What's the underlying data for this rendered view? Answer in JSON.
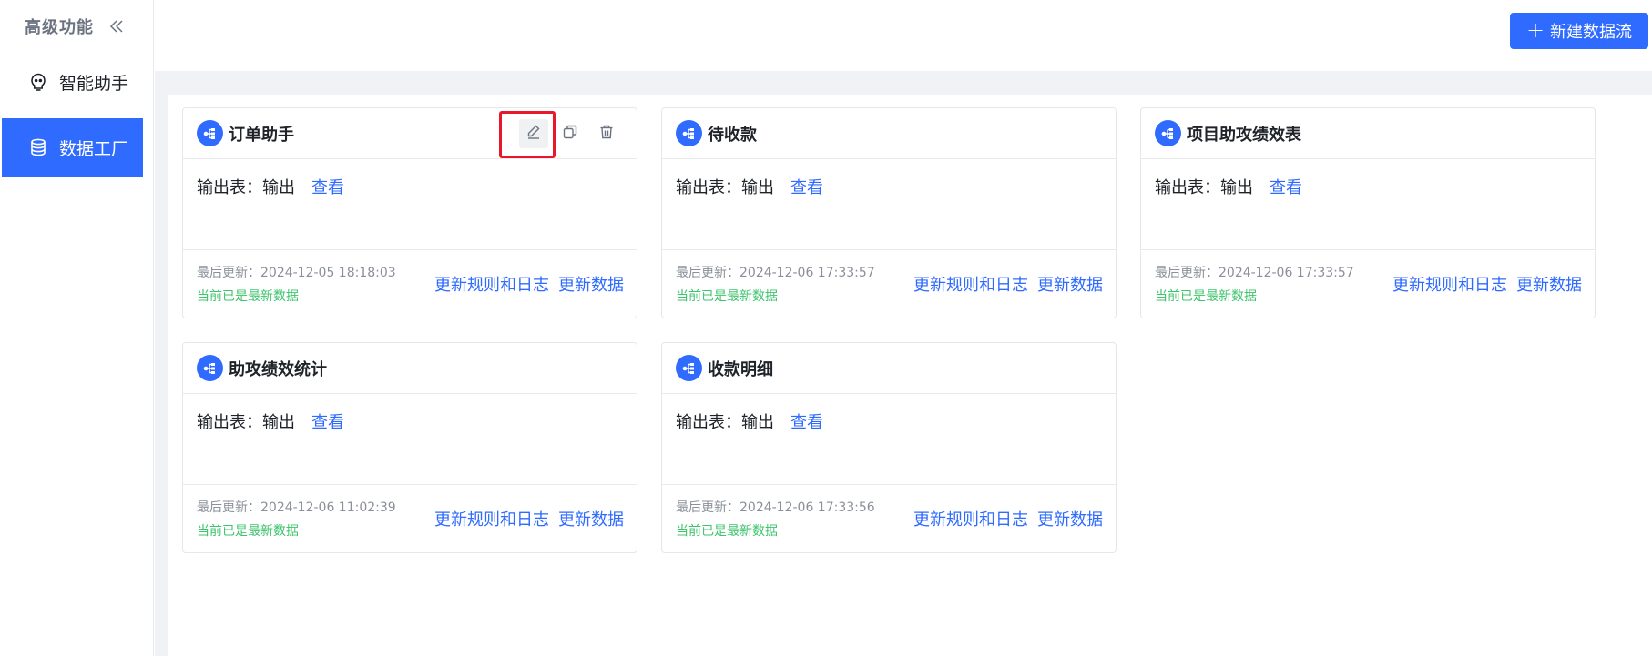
{
  "sidebar": {
    "title": "高级功能",
    "collapse_icon": "double-chevron-left-icon",
    "items": [
      {
        "label": "智能助手",
        "icon": "bulb-robot-icon",
        "active": false
      },
      {
        "label": "数据工厂",
        "icon": "database-icon",
        "active": true
      }
    ]
  },
  "toolbar": {
    "new_button_icon": "+",
    "new_button_label": "新建数据流"
  },
  "colors": {
    "accent": "#2f6bff",
    "success": "#3ec46d",
    "highlight": "#e8182a"
  },
  "cards": [
    {
      "title": "订单助手",
      "output_label": "输出表：输出",
      "view_label": "查看",
      "updated_at": "最后更新：2024-12-05 18:18:03",
      "status": "当前已是最新数据",
      "rules_link": "更新规则和日志",
      "update_link": "更新数据"
    },
    {
      "title": "待收款",
      "output_label": "输出表：输出",
      "view_label": "查看",
      "updated_at": "最后更新：2024-12-06 17:33:57",
      "status": "当前已是最新数据",
      "rules_link": "更新规则和日志",
      "update_link": "更新数据"
    },
    {
      "title": "项目助攻绩效表",
      "output_label": "输出表：输出",
      "view_label": "查看",
      "updated_at": "最后更新：2024-12-06 17:33:57",
      "status": "当前已是最新数据",
      "rules_link": "更新规则和日志",
      "update_link": "更新数据"
    },
    {
      "title": "助攻绩效统计",
      "output_label": "输出表：输出",
      "view_label": "查看",
      "updated_at": "最后更新：2024-12-06 11:02:39",
      "status": "当前已是最新数据",
      "rules_link": "更新规则和日志",
      "update_link": "更新数据"
    },
    {
      "title": "收款明细",
      "output_label": "输出表：输出",
      "view_label": "查看",
      "updated_at": "最后更新：2024-12-06 17:33:56",
      "status": "当前已是最新数据",
      "rules_link": "更新规则和日志",
      "update_link": "更新数据"
    }
  ]
}
